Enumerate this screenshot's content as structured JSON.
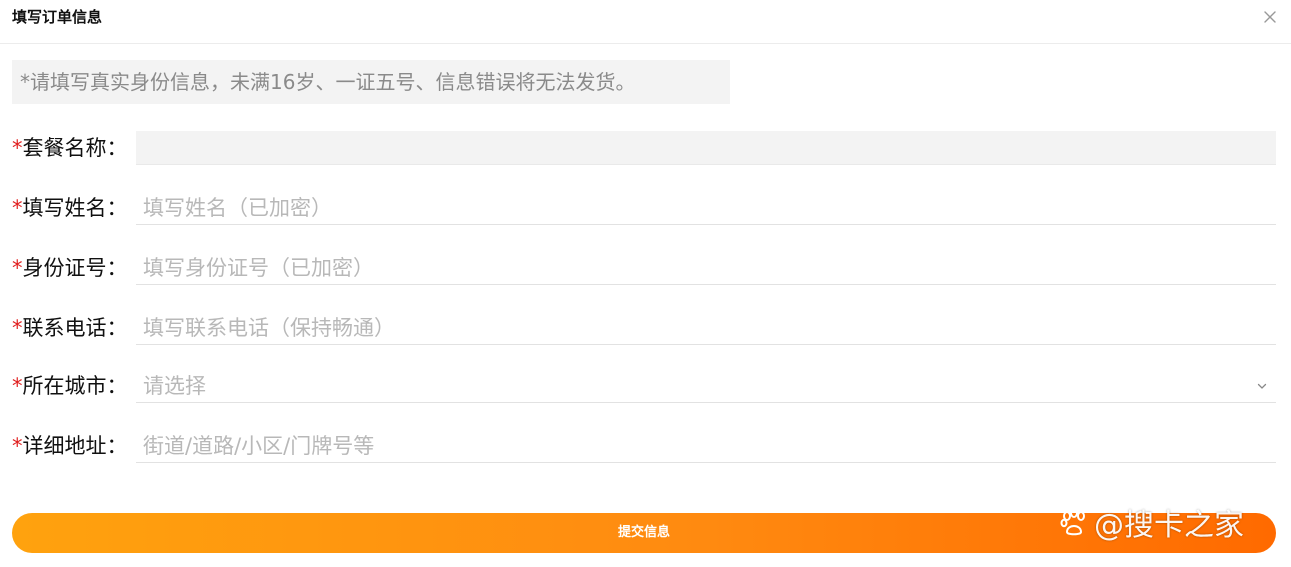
{
  "dialog": {
    "title": "填写订单信息",
    "close_icon": "close-icon"
  },
  "notice": "*请填写真实身份信息，未满16岁、一证五号、信息错误将无法发货。",
  "form": {
    "required_mark": "*",
    "package": {
      "label": "套餐名称：",
      "value": ""
    },
    "name": {
      "label": "填写姓名：",
      "placeholder": "填写姓名（已加密）"
    },
    "id_number": {
      "label": "身份证号：",
      "placeholder": "填写身份证号（已加密）"
    },
    "phone": {
      "label": "联系电话：",
      "placeholder": "填写联系电话（保持畅通）"
    },
    "city": {
      "label": "所在城市：",
      "placeholder": "请选择",
      "icon": "chevron-down-icon"
    },
    "address": {
      "label": "详细地址：",
      "placeholder": "街道/道路/小区/门牌号等"
    }
  },
  "submit_label": "提交信息",
  "watermark": {
    "text": "@搜卡之家",
    "icon": "paw-icon"
  },
  "colors": {
    "accent_start": "#ffa20e",
    "accent_end": "#ff6a00",
    "required": "#e02020",
    "placeholder": "#b8b8b8"
  }
}
